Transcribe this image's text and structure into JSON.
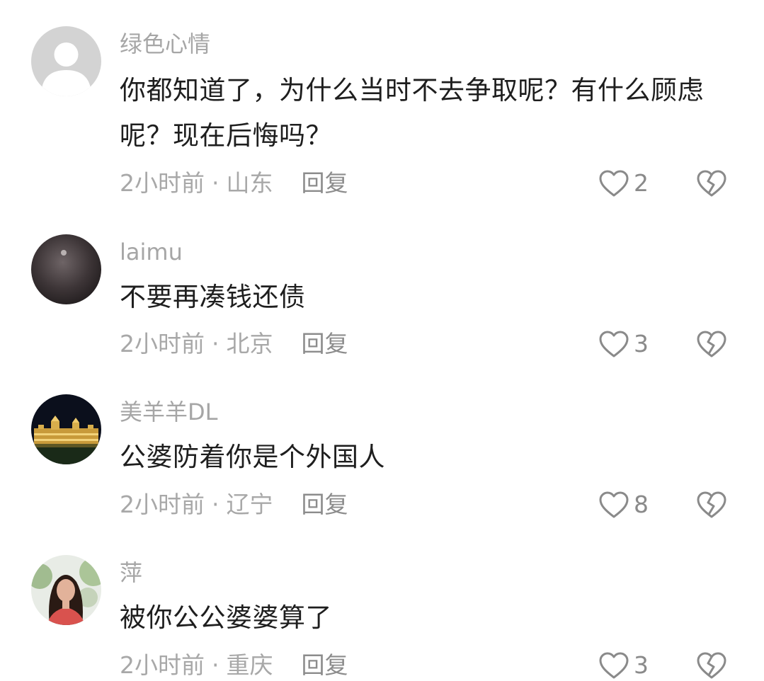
{
  "colors": {
    "username": "#a6a6a6",
    "text": "#1e1e1e",
    "meta": "#a8a8a8",
    "icon": "#8a8a8a",
    "background": "#ffffff"
  },
  "icons": {
    "like": "heart-outline-icon",
    "dislike": "broken-heart-icon"
  },
  "comments": [
    {
      "username": "绿色心情",
      "text": "你都知道了，为什么当时不去争取呢？有什么顾虑呢？现在后悔吗？",
      "time": "2小时前",
      "separator": "·",
      "location": "山东",
      "reply_label": "回复",
      "likes": "2"
    },
    {
      "username": "laimu",
      "text": "不要再凑钱还债",
      "time": "2小时前",
      "separator": "·",
      "location": "北京",
      "reply_label": "回复",
      "likes": "3"
    },
    {
      "username": "美羊羊DL",
      "text": "公婆防着你是个外国人",
      "time": "2小时前",
      "separator": "·",
      "location": "辽宁",
      "reply_label": "回复",
      "likes": "8"
    },
    {
      "username": "萍",
      "text": "被你公公婆婆算了",
      "time": "2小时前",
      "separator": "·",
      "location": "重庆",
      "reply_label": "回复",
      "likes": "3"
    }
  ]
}
